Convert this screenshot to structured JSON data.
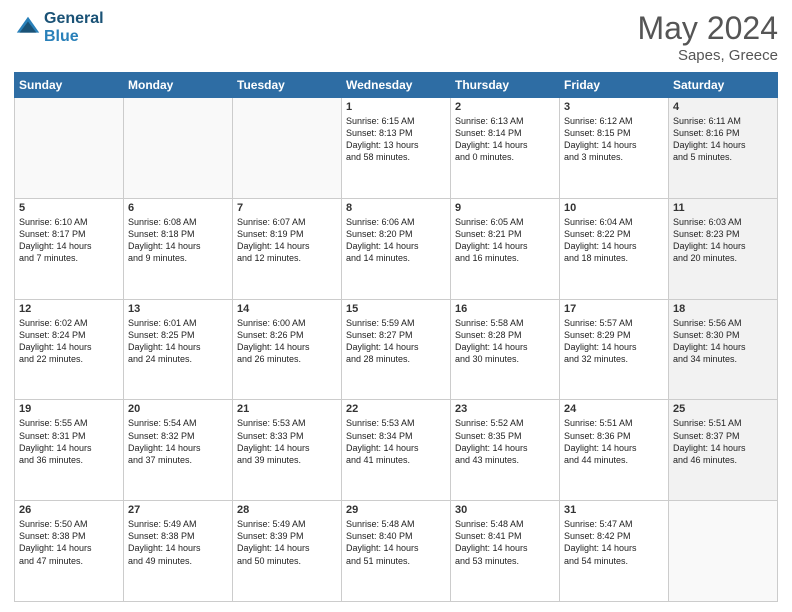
{
  "header": {
    "logo_line1": "General",
    "logo_line2": "Blue",
    "month_year": "May 2024",
    "location": "Sapes, Greece"
  },
  "weekdays": [
    "Sunday",
    "Monday",
    "Tuesday",
    "Wednesday",
    "Thursday",
    "Friday",
    "Saturday"
  ],
  "rows": [
    [
      {
        "day": "",
        "content": "",
        "empty": true
      },
      {
        "day": "",
        "content": "",
        "empty": true
      },
      {
        "day": "",
        "content": "",
        "empty": true
      },
      {
        "day": "1",
        "content": "Sunrise: 6:15 AM\nSunset: 8:13 PM\nDaylight: 13 hours\nand 58 minutes.",
        "shaded": false
      },
      {
        "day": "2",
        "content": "Sunrise: 6:13 AM\nSunset: 8:14 PM\nDaylight: 14 hours\nand 0 minutes.",
        "shaded": false
      },
      {
        "day": "3",
        "content": "Sunrise: 6:12 AM\nSunset: 8:15 PM\nDaylight: 14 hours\nand 3 minutes.",
        "shaded": false
      },
      {
        "day": "4",
        "content": "Sunrise: 6:11 AM\nSunset: 8:16 PM\nDaylight: 14 hours\nand 5 minutes.",
        "shaded": true
      }
    ],
    [
      {
        "day": "5",
        "content": "Sunrise: 6:10 AM\nSunset: 8:17 PM\nDaylight: 14 hours\nand 7 minutes.",
        "shaded": false
      },
      {
        "day": "6",
        "content": "Sunrise: 6:08 AM\nSunset: 8:18 PM\nDaylight: 14 hours\nand 9 minutes.",
        "shaded": false
      },
      {
        "day": "7",
        "content": "Sunrise: 6:07 AM\nSunset: 8:19 PM\nDaylight: 14 hours\nand 12 minutes.",
        "shaded": false
      },
      {
        "day": "8",
        "content": "Sunrise: 6:06 AM\nSunset: 8:20 PM\nDaylight: 14 hours\nand 14 minutes.",
        "shaded": false
      },
      {
        "day": "9",
        "content": "Sunrise: 6:05 AM\nSunset: 8:21 PM\nDaylight: 14 hours\nand 16 minutes.",
        "shaded": false
      },
      {
        "day": "10",
        "content": "Sunrise: 6:04 AM\nSunset: 8:22 PM\nDaylight: 14 hours\nand 18 minutes.",
        "shaded": false
      },
      {
        "day": "11",
        "content": "Sunrise: 6:03 AM\nSunset: 8:23 PM\nDaylight: 14 hours\nand 20 minutes.",
        "shaded": true
      }
    ],
    [
      {
        "day": "12",
        "content": "Sunrise: 6:02 AM\nSunset: 8:24 PM\nDaylight: 14 hours\nand 22 minutes.",
        "shaded": false
      },
      {
        "day": "13",
        "content": "Sunrise: 6:01 AM\nSunset: 8:25 PM\nDaylight: 14 hours\nand 24 minutes.",
        "shaded": false
      },
      {
        "day": "14",
        "content": "Sunrise: 6:00 AM\nSunset: 8:26 PM\nDaylight: 14 hours\nand 26 minutes.",
        "shaded": false
      },
      {
        "day": "15",
        "content": "Sunrise: 5:59 AM\nSunset: 8:27 PM\nDaylight: 14 hours\nand 28 minutes.",
        "shaded": false
      },
      {
        "day": "16",
        "content": "Sunrise: 5:58 AM\nSunset: 8:28 PM\nDaylight: 14 hours\nand 30 minutes.",
        "shaded": false
      },
      {
        "day": "17",
        "content": "Sunrise: 5:57 AM\nSunset: 8:29 PM\nDaylight: 14 hours\nand 32 minutes.",
        "shaded": false
      },
      {
        "day": "18",
        "content": "Sunrise: 5:56 AM\nSunset: 8:30 PM\nDaylight: 14 hours\nand 34 minutes.",
        "shaded": true
      }
    ],
    [
      {
        "day": "19",
        "content": "Sunrise: 5:55 AM\nSunset: 8:31 PM\nDaylight: 14 hours\nand 36 minutes.",
        "shaded": false
      },
      {
        "day": "20",
        "content": "Sunrise: 5:54 AM\nSunset: 8:32 PM\nDaylight: 14 hours\nand 37 minutes.",
        "shaded": false
      },
      {
        "day": "21",
        "content": "Sunrise: 5:53 AM\nSunset: 8:33 PM\nDaylight: 14 hours\nand 39 minutes.",
        "shaded": false
      },
      {
        "day": "22",
        "content": "Sunrise: 5:53 AM\nSunset: 8:34 PM\nDaylight: 14 hours\nand 41 minutes.",
        "shaded": false
      },
      {
        "day": "23",
        "content": "Sunrise: 5:52 AM\nSunset: 8:35 PM\nDaylight: 14 hours\nand 43 minutes.",
        "shaded": false
      },
      {
        "day": "24",
        "content": "Sunrise: 5:51 AM\nSunset: 8:36 PM\nDaylight: 14 hours\nand 44 minutes.",
        "shaded": false
      },
      {
        "day": "25",
        "content": "Sunrise: 5:51 AM\nSunset: 8:37 PM\nDaylight: 14 hours\nand 46 minutes.",
        "shaded": true
      }
    ],
    [
      {
        "day": "26",
        "content": "Sunrise: 5:50 AM\nSunset: 8:38 PM\nDaylight: 14 hours\nand 47 minutes.",
        "shaded": false
      },
      {
        "day": "27",
        "content": "Sunrise: 5:49 AM\nSunset: 8:38 PM\nDaylight: 14 hours\nand 49 minutes.",
        "shaded": false
      },
      {
        "day": "28",
        "content": "Sunrise: 5:49 AM\nSunset: 8:39 PM\nDaylight: 14 hours\nand 50 minutes.",
        "shaded": false
      },
      {
        "day": "29",
        "content": "Sunrise: 5:48 AM\nSunset: 8:40 PM\nDaylight: 14 hours\nand 51 minutes.",
        "shaded": false
      },
      {
        "day": "30",
        "content": "Sunrise: 5:48 AM\nSunset: 8:41 PM\nDaylight: 14 hours\nand 53 minutes.",
        "shaded": false
      },
      {
        "day": "31",
        "content": "Sunrise: 5:47 AM\nSunset: 8:42 PM\nDaylight: 14 hours\nand 54 minutes.",
        "shaded": false
      },
      {
        "day": "",
        "content": "",
        "empty": true
      }
    ]
  ]
}
